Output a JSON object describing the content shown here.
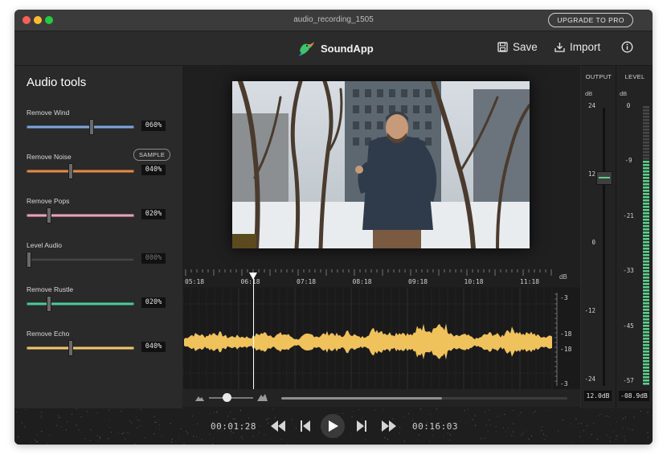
{
  "window": {
    "title": "audio_recording_1505",
    "upgrade_label": "UPGRADE TO PRO"
  },
  "header": {
    "app_name": "SoundApp",
    "save_label": "Save",
    "import_label": "Import"
  },
  "sidebar": {
    "title": "Audio tools",
    "tools": [
      {
        "label": "Remove Wind",
        "value": "060%",
        "level": 0.6,
        "color": "#7fa6d9"
      },
      {
        "label": "Remove Noise",
        "value": "040%",
        "level": 0.4,
        "color": "#e08a4a",
        "extra": "SAMPLE"
      },
      {
        "label": "Remove Pops",
        "value": "020%",
        "level": 0.2,
        "color": "#e7a2b8"
      },
      {
        "label": "Level Audio",
        "value": "000%",
        "level": 0.0,
        "color": "#4a4a4a"
      },
      {
        "label": "Remove Rustle",
        "value": "020%",
        "level": 0.2,
        "color": "#4fc79a"
      },
      {
        "label": "Remove Echo",
        "value": "040%",
        "level": 0.4,
        "color": "#e8c86c"
      }
    ]
  },
  "timeline": {
    "ticks": [
      "05:18",
      "06:18",
      "07:18",
      "08:18",
      "09:18",
      "10:18",
      "11:18"
    ],
    "db_label": "dB",
    "db_ticks": [
      "-3",
      "-18",
      "-18",
      "-3"
    ]
  },
  "meters": {
    "output_title": "OUTPUT",
    "level_title": "LEVEL",
    "db_label": "dB",
    "output_ticks": [
      "24",
      "12",
      "0",
      "-12",
      "-24"
    ],
    "level_ticks": [
      "0",
      "-9",
      "-21",
      "-33",
      "-45",
      "-57"
    ],
    "output_value": "12.0dB",
    "level_value": "-08.9dB",
    "colors": {
      "meter": "#5bd08a"
    }
  },
  "transport": {
    "current_time": "00:01:28",
    "total_time": "00:16:03"
  },
  "colors": {
    "waveform": "#f0c25c"
  }
}
